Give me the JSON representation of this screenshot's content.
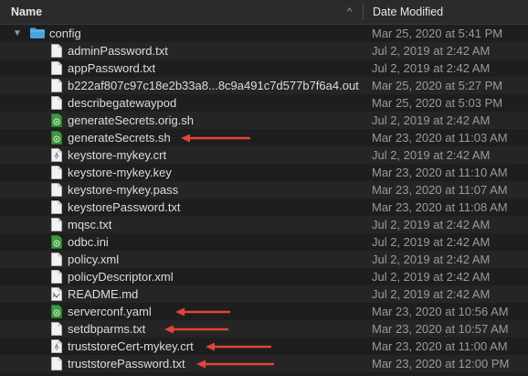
{
  "header": {
    "name_label": "Name",
    "date_label": "Date Modified",
    "sort_glyph": "^"
  },
  "folder": {
    "name": "config",
    "date": "Mar 25, 2020 at 5:41 PM",
    "icon": "folder-icon",
    "expanded": true
  },
  "files": [
    {
      "name": "adminPassword.txt",
      "date": "Jul 2, 2019 at 2:42 AM",
      "icon": "text-file-icon"
    },
    {
      "name": "appPassword.txt",
      "date": "Jul 2, 2019 at 2:42 AM",
      "icon": "text-file-icon"
    },
    {
      "name": "b222af807c97c18e2b33a8...8c9a491c7d577b7f6a4.out",
      "date": "Mar 25, 2020 at 5:27 PM",
      "icon": "text-file-icon"
    },
    {
      "name": "describegatewaypod",
      "date": "Mar 25, 2020 at 5:03 PM",
      "icon": "text-file-icon"
    },
    {
      "name": "generateSecrets.orig.sh",
      "date": "Jul 2, 2019 at 2:42 AM",
      "icon": "script-file-icon"
    },
    {
      "name": "generateSecrets.sh",
      "date": "Mar 23, 2020 at 11:03 AM",
      "icon": "script-file-icon",
      "arrow": true
    },
    {
      "name": "keystore-mykey.crt",
      "date": "Jul 2, 2019 at 2:42 AM",
      "icon": "certificate-file-icon"
    },
    {
      "name": "keystore-mykey.key",
      "date": "Mar 23, 2020 at 11:10 AM",
      "icon": "text-file-icon"
    },
    {
      "name": "keystore-mykey.pass",
      "date": "Mar 23, 2020 at 11:07 AM",
      "icon": "text-file-icon"
    },
    {
      "name": "keystorePassword.txt",
      "date": "Mar 23, 2020 at 11:08 AM",
      "icon": "text-file-icon"
    },
    {
      "name": "mqsc.txt",
      "date": "Jul 2, 2019 at 2:42 AM",
      "icon": "text-file-icon"
    },
    {
      "name": "odbc.ini",
      "date": "Jul 2, 2019 at 2:42 AM",
      "icon": "script-file-icon"
    },
    {
      "name": "policy.xml",
      "date": "Jul 2, 2019 at 2:42 AM",
      "icon": "text-file-icon"
    },
    {
      "name": "policyDescriptor.xml",
      "date": "Jul 2, 2019 at 2:42 AM",
      "icon": "text-file-icon"
    },
    {
      "name": "README.md",
      "date": "Jul 2, 2019 at 2:42 AM",
      "icon": "markdown-file-icon"
    },
    {
      "name": "serverconf.yaml",
      "date": "Mar 23, 2020 at 10:56 AM",
      "icon": "script-file-icon",
      "arrow": true
    },
    {
      "name": "setdbparms.txt",
      "date": "Mar 23, 2020 at 10:57 AM",
      "icon": "text-file-icon",
      "arrow": true
    },
    {
      "name": "truststoreCert-mykey.crt",
      "date": "Mar 23, 2020 at 11:00 AM",
      "icon": "certificate-file-icon",
      "arrow": true
    },
    {
      "name": "truststorePassword.txt",
      "date": "Mar 23, 2020 at 12:00 PM",
      "icon": "text-file-icon",
      "arrow": true
    }
  ],
  "colors": {
    "annotation_arrow": "#e0463a",
    "script_icon": "#3e9a3e",
    "folder": "#4aa3e0"
  }
}
